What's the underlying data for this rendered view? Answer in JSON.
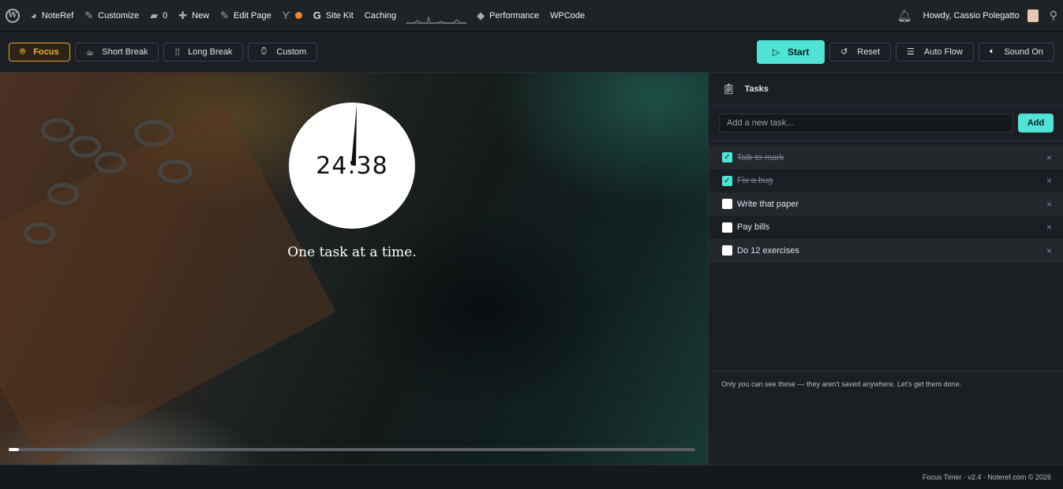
{
  "adminbar": {
    "site": "NoteRef",
    "customize": "Customize",
    "comments_count": "0",
    "new": "New",
    "edit_page": "Edit Page",
    "site_kit": "Site Kit",
    "caching": "Caching",
    "performance": "Performance",
    "wpcode": "WPCode",
    "howdy": "Howdy, Cassio Polegatto"
  },
  "toolbar": {
    "modes": [
      {
        "label": "Focus",
        "icon": "focus-icon",
        "active": true
      },
      {
        "label": "Short Break",
        "icon": "coffee-icon"
      },
      {
        "label": "Long Break",
        "icon": "footprints-icon"
      },
      {
        "label": "Custom",
        "icon": "watch-icon"
      }
    ],
    "start": "Start",
    "reset": "Reset",
    "auto_flow": "Auto Flow",
    "sound": "Sound On"
  },
  "timer": {
    "display": "24:38",
    "motto": "One task at a time.",
    "progress": 0.015
  },
  "tasks": {
    "title": "Tasks",
    "input_placeholder": "Add a new task...",
    "add_label": "Add",
    "items": [
      {
        "text": "Talk to mark",
        "done": true
      },
      {
        "text": "Fix a bug",
        "done": true
      },
      {
        "text": "Write that paper",
        "done": false
      },
      {
        "text": "Pay bills",
        "done": false
      },
      {
        "text": "Do 12 exercises",
        "done": false
      }
    ],
    "note": "Only you can see these — they aren't saved anywhere. Let's get them done."
  },
  "footer": "Focus Timer · v2.4 · Noteref.com © 2026",
  "colors": {
    "accent": "#4fe3d6",
    "focus": "#f1a93a",
    "admin_bar": "#1d2327"
  }
}
